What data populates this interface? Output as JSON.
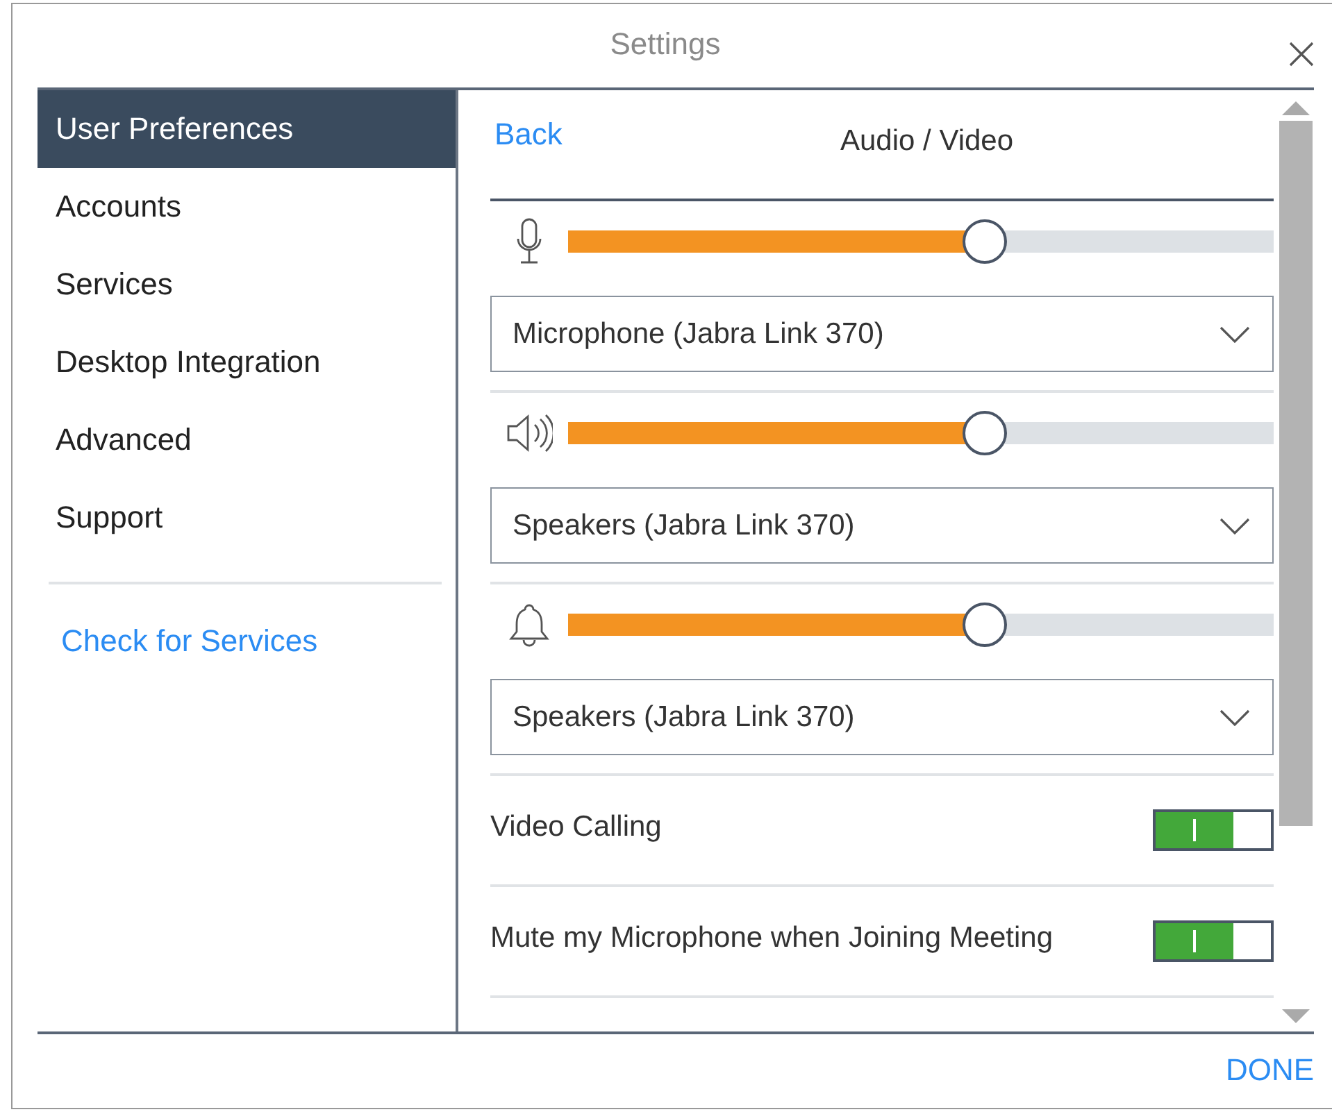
{
  "window": {
    "title": "Settings"
  },
  "sidebar": {
    "items": [
      {
        "label": "User Preferences",
        "selected": true
      },
      {
        "label": "Accounts",
        "selected": false
      },
      {
        "label": "Services",
        "selected": false
      },
      {
        "label": "Desktop Integration",
        "selected": false
      },
      {
        "label": "Advanced",
        "selected": false
      },
      {
        "label": "Support",
        "selected": false
      }
    ],
    "link": "Check for Services"
  },
  "panel": {
    "back": "Back",
    "title": "Audio / Video",
    "channels": [
      {
        "kind": "microphone",
        "level": 0.59,
        "device": "Microphone (Jabra Link 370)"
      },
      {
        "kind": "speaker",
        "level": 0.59,
        "device": "Speakers (Jabra Link 370)"
      },
      {
        "kind": "bell",
        "level": 0.59,
        "device": "Speakers (Jabra Link 370)"
      }
    ],
    "toggles": [
      {
        "label": "Video Calling",
        "on": true
      },
      {
        "label": "Mute my Microphone when Joining Meeting",
        "on": true
      }
    ]
  },
  "footer": {
    "button": "DONE"
  }
}
